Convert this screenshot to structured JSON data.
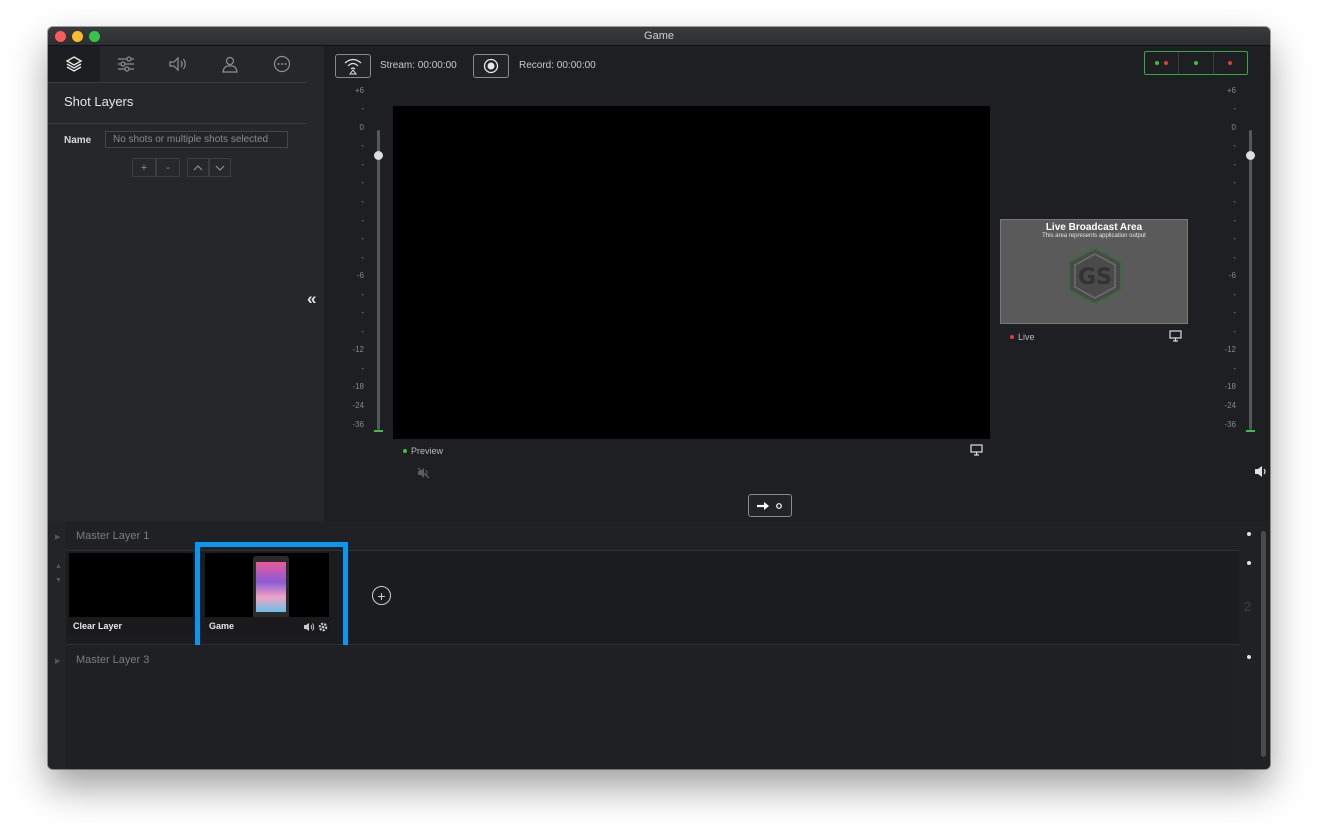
{
  "window": {
    "title": "Game"
  },
  "left_panel": {
    "tabs": [
      {
        "icon": "layers-icon",
        "active": true
      },
      {
        "icon": "sliders-icon",
        "active": false
      },
      {
        "icon": "speaker-icon",
        "active": false
      },
      {
        "icon": "person-icon",
        "active": false
      },
      {
        "icon": "more-icon",
        "active": false
      }
    ],
    "heading": "Shot Layers",
    "name_label": "Name",
    "name_placeholder": "No shots or multiple shots selected",
    "buttons": {
      "add": "+",
      "remove": "-",
      "up": "^",
      "down": "v"
    },
    "collapse": "«"
  },
  "toolbar": {
    "stream_label": "Stream: 00:00:00",
    "record_label": "Record: 00:00:00"
  },
  "meters": {
    "ticks": [
      "+6",
      "-",
      "0",
      "-",
      "-",
      "-",
      "-",
      "-",
      "-",
      "-",
      "-6",
      "-",
      "-",
      "-",
      "-12",
      "-",
      "-18",
      "-24",
      "-36"
    ]
  },
  "preview": {
    "label": "Preview"
  },
  "live": {
    "title": "Live Broadcast Area",
    "subtitle": "This area represents application output",
    "label": "Live"
  },
  "layers": {
    "layer1": "Master Layer 1",
    "layer2_number": "2",
    "layer3": "Master Layer 3",
    "shots": [
      {
        "label": "Clear Layer"
      },
      {
        "label": "Game"
      }
    ]
  },
  "colors": {
    "accent_blue": "#0b96f0",
    "live_red": "#e13b3b",
    "preview_green": "#38c23f"
  }
}
